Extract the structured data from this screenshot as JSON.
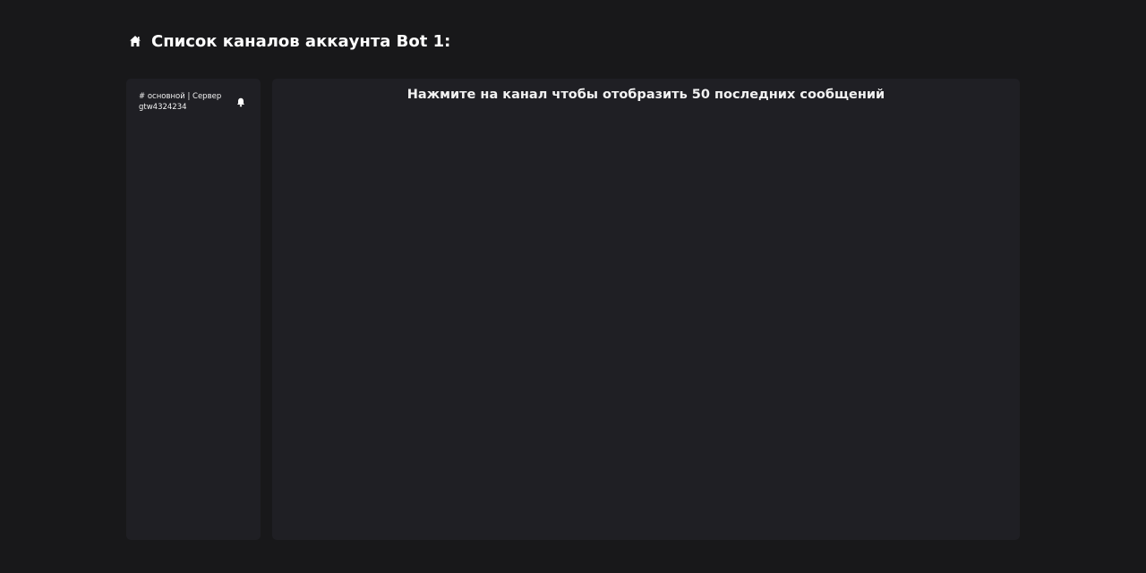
{
  "header": {
    "icon": "home-icon",
    "title": "Список каналов аккаунта Bot 1:"
  },
  "sidebar": {
    "channels": [
      {
        "label": "# основной | Сервер gtw4324234",
        "icon": "bell-icon"
      }
    ]
  },
  "main": {
    "hint": "Нажмите на канал чтобы отобразить 50 последних сообщений"
  },
  "colors": {
    "background": "#18181a",
    "panel": "#1f1f24",
    "text": "#ffffff"
  }
}
